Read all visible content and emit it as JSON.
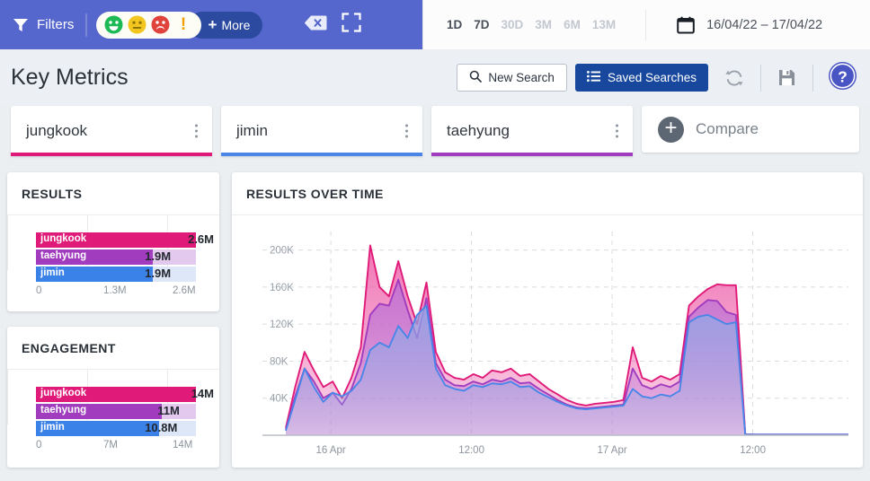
{
  "topbar": {
    "filters_label": "Filters",
    "filter_icon": "funnel-icon",
    "sentiments": [
      {
        "name": "positive-sentiment-icon",
        "color": "#1db954",
        "glyph": "smile"
      },
      {
        "name": "neutral-sentiment-icon",
        "color": "#f2c61e",
        "glyph": "neutral"
      },
      {
        "name": "negative-sentiment-icon",
        "color": "#e0423c",
        "glyph": "frown"
      },
      {
        "name": "alert-sentiment-icon",
        "color": "#f0a000",
        "glyph": "exclamation"
      }
    ],
    "more_label": "More",
    "more_plus": "+",
    "clear_icon": "clear-backspace-icon",
    "fullscreen_icon": "fullscreen-icon",
    "ranges": [
      {
        "label": "1D",
        "active": true
      },
      {
        "label": "7D",
        "active": true
      },
      {
        "label": "30D",
        "active": false
      },
      {
        "label": "3M",
        "active": false
      },
      {
        "label": "6M",
        "active": false
      },
      {
        "label": "13M",
        "active": false
      }
    ],
    "calendar_icon": "calendar-icon",
    "date_range": "16/04/22 – 17/04/22",
    "bar_color": "#5566cc",
    "more_btn_color": "#2b4aa0"
  },
  "header": {
    "title": "Key Metrics",
    "new_search_label": "New Search",
    "new_search_icon": "search-icon",
    "saved_searches_label": "Saved Searches",
    "saved_searches_icon": "list-icon",
    "refresh_icon": "refresh-icon",
    "save_icon": "floppy-save-icon",
    "help_icon": "help-question-icon",
    "accent_blue": "#17489e"
  },
  "tabs": {
    "terms": [
      {
        "label": "jungkook",
        "color": "#e01a78",
        "menu_icon": "kebab-menu-icon"
      },
      {
        "label": "jimin",
        "color": "#4a86e8",
        "menu_icon": "kebab-menu-icon"
      },
      {
        "label": "taehyung",
        "color": "#a13cbf",
        "menu_icon": "kebab-menu-icon"
      }
    ],
    "compare_label": "Compare",
    "compare_icon": "plus-circle-icon"
  },
  "results_card": {
    "title": "RESULTS",
    "chart_data": {
      "type": "bar",
      "title": "RESULTS",
      "categories": [
        "jungkook",
        "taehyung",
        "jimin"
      ],
      "values": [
        2600000,
        1900000,
        1900000
      ],
      "value_labels": [
        "2.6M",
        "1.9M",
        "1.9M"
      ],
      "colors": [
        "#e01a78",
        "#a13cbf",
        "#3b82e8"
      ],
      "track_colors": [
        "#f7c4dd",
        "#e3c9ee",
        "#dde7f8"
      ],
      "axis_ticks": [
        "0",
        "1.3M",
        "2.6M"
      ],
      "xlim": [
        0,
        2600000
      ],
      "orientation": "horizontal"
    }
  },
  "engagement_card": {
    "title": "ENGAGEMENT",
    "chart_data": {
      "type": "bar",
      "title": "ENGAGEMENT",
      "categories": [
        "jungkook",
        "taehyung",
        "jimin"
      ],
      "values": [
        14000000,
        11000000,
        10800000
      ],
      "value_labels": [
        "14M",
        "11M",
        "10.8M"
      ],
      "colors": [
        "#e01a78",
        "#a13cbf",
        "#3b82e8"
      ],
      "track_colors": [
        "#f7c4dd",
        "#e3c9ee",
        "#dde7f8"
      ],
      "axis_ticks": [
        "0",
        "7M",
        "14M"
      ],
      "xlim": [
        0,
        14000000
      ],
      "orientation": "horizontal"
    }
  },
  "chart_card": {
    "title": "RESULTS OVER TIME",
    "chart_data": {
      "type": "area",
      "title": "RESULTS OVER TIME",
      "xlabel": "",
      "ylabel": "",
      "ylim": [
        0,
        220000
      ],
      "yticks": [
        40000,
        80000,
        120000,
        160000,
        200000
      ],
      "ytick_labels": [
        "40K",
        "80K",
        "120K",
        "160K",
        "200K"
      ],
      "xticks": [
        "16 Apr",
        "12:00",
        "17 Apr",
        "12:00"
      ],
      "xtick_positions": [
        0.08,
        0.33,
        0.58,
        0.83
      ],
      "grid": true,
      "legend_position": "none",
      "x": [
        0,
        1,
        2,
        3,
        4,
        5,
        6,
        7,
        8,
        9,
        10,
        11,
        12,
        13,
        14,
        15,
        16,
        17,
        18,
        19,
        20,
        21,
        22,
        23,
        24,
        25,
        26,
        27,
        28,
        29,
        30,
        31,
        32,
        33,
        34,
        35,
        36,
        37,
        38,
        39,
        40,
        41,
        42,
        43,
        44,
        45,
        46,
        47,
        48,
        49,
        50,
        51,
        52,
        53,
        54,
        55,
        56,
        57,
        58,
        59,
        60
      ],
      "series": [
        {
          "name": "jungkook",
          "color": "#e01a78",
          "fill": "#ec4ea0",
          "values": [
            8000,
            52000,
            90000,
            70000,
            52000,
            58000,
            40000,
            62000,
            95000,
            205000,
            160000,
            150000,
            188000,
            150000,
            120000,
            165000,
            90000,
            68000,
            62000,
            60000,
            66000,
            62000,
            70000,
            68000,
            72000,
            64000,
            66000,
            58000,
            50000,
            44000,
            38000,
            34000,
            32000,
            34000,
            35000,
            36000,
            38000,
            95000,
            62000,
            58000,
            64000,
            60000,
            66000,
            140000,
            150000,
            158000,
            163000,
            162000,
            162000,
            1000,
            800,
            800,
            800,
            800,
            800,
            800,
            800,
            800,
            800,
            800,
            800
          ]
        },
        {
          "name": "taehyung",
          "color": "#a13cbf",
          "fill": "#b96fd6",
          "values": [
            6000,
            42000,
            72000,
            58000,
            40000,
            46000,
            33000,
            50000,
            78000,
            130000,
            142000,
            140000,
            168000,
            135000,
            105000,
            148000,
            78000,
            60000,
            54000,
            53000,
            58000,
            55000,
            60000,
            58000,
            62000,
            56000,
            57000,
            50000,
            44000,
            38000,
            33000,
            30000,
            29000,
            30000,
            31000,
            32000,
            33000,
            72000,
            54000,
            50000,
            55000,
            52000,
            58000,
            128000,
            138000,
            146000,
            145000,
            133000,
            130000,
            900,
            700,
            700,
            700,
            700,
            700,
            700,
            700,
            700,
            700,
            700,
            700
          ]
        },
        {
          "name": "jimin",
          "color": "#4a86e8",
          "fill": "#8fa9e8",
          "values": [
            5000,
            38000,
            72000,
            52000,
            36000,
            46000,
            42000,
            48000,
            60000,
            92000,
            100000,
            95000,
            118000,
            105000,
            130000,
            140000,
            72000,
            54000,
            50000,
            48000,
            54000,
            52000,
            56000,
            55000,
            58000,
            52000,
            53000,
            46000,
            41000,
            36000,
            32000,
            29000,
            28000,
            29000,
            30000,
            31000,
            32000,
            50000,
            42000,
            40000,
            44000,
            42000,
            48000,
            122000,
            128000,
            130000,
            125000,
            120000,
            122000,
            800,
            600,
            600,
            600,
            600,
            600,
            600,
            600,
            600,
            600,
            600,
            600
          ]
        }
      ]
    }
  }
}
